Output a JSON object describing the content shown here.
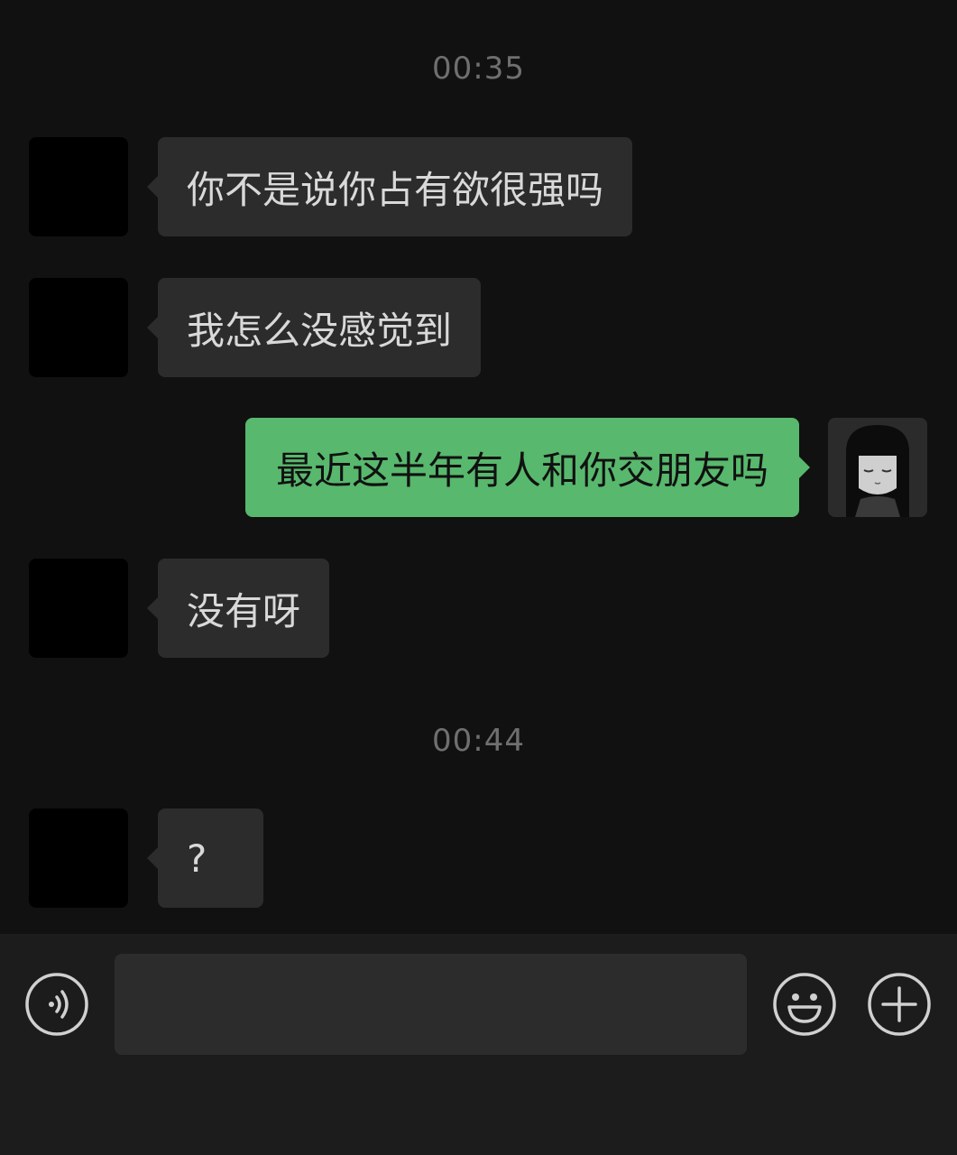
{
  "colors": {
    "background": "#111111",
    "incoming_bubble": "#2c2c2c",
    "outgoing_bubble": "#58b86d",
    "timestamp": "#6f6f6f",
    "input_bar": "#1c1c1c"
  },
  "chat": {
    "timestamps": [
      "00:35",
      "00:44"
    ],
    "messages": [
      {
        "side": "incoming",
        "text": "你不是说你占有欲很强吗"
      },
      {
        "side": "incoming",
        "text": "我怎么没感觉到"
      },
      {
        "side": "outgoing",
        "text": "最近这半年有人和你交朋友吗"
      },
      {
        "side": "incoming",
        "text": "没有呀"
      },
      {
        "side": "incoming",
        "text": "?"
      }
    ]
  },
  "input_bar": {
    "voice_icon": "voice-icon",
    "message_value": "",
    "emoji_icon": "emoji-icon",
    "plus_icon": "plus-icon"
  }
}
